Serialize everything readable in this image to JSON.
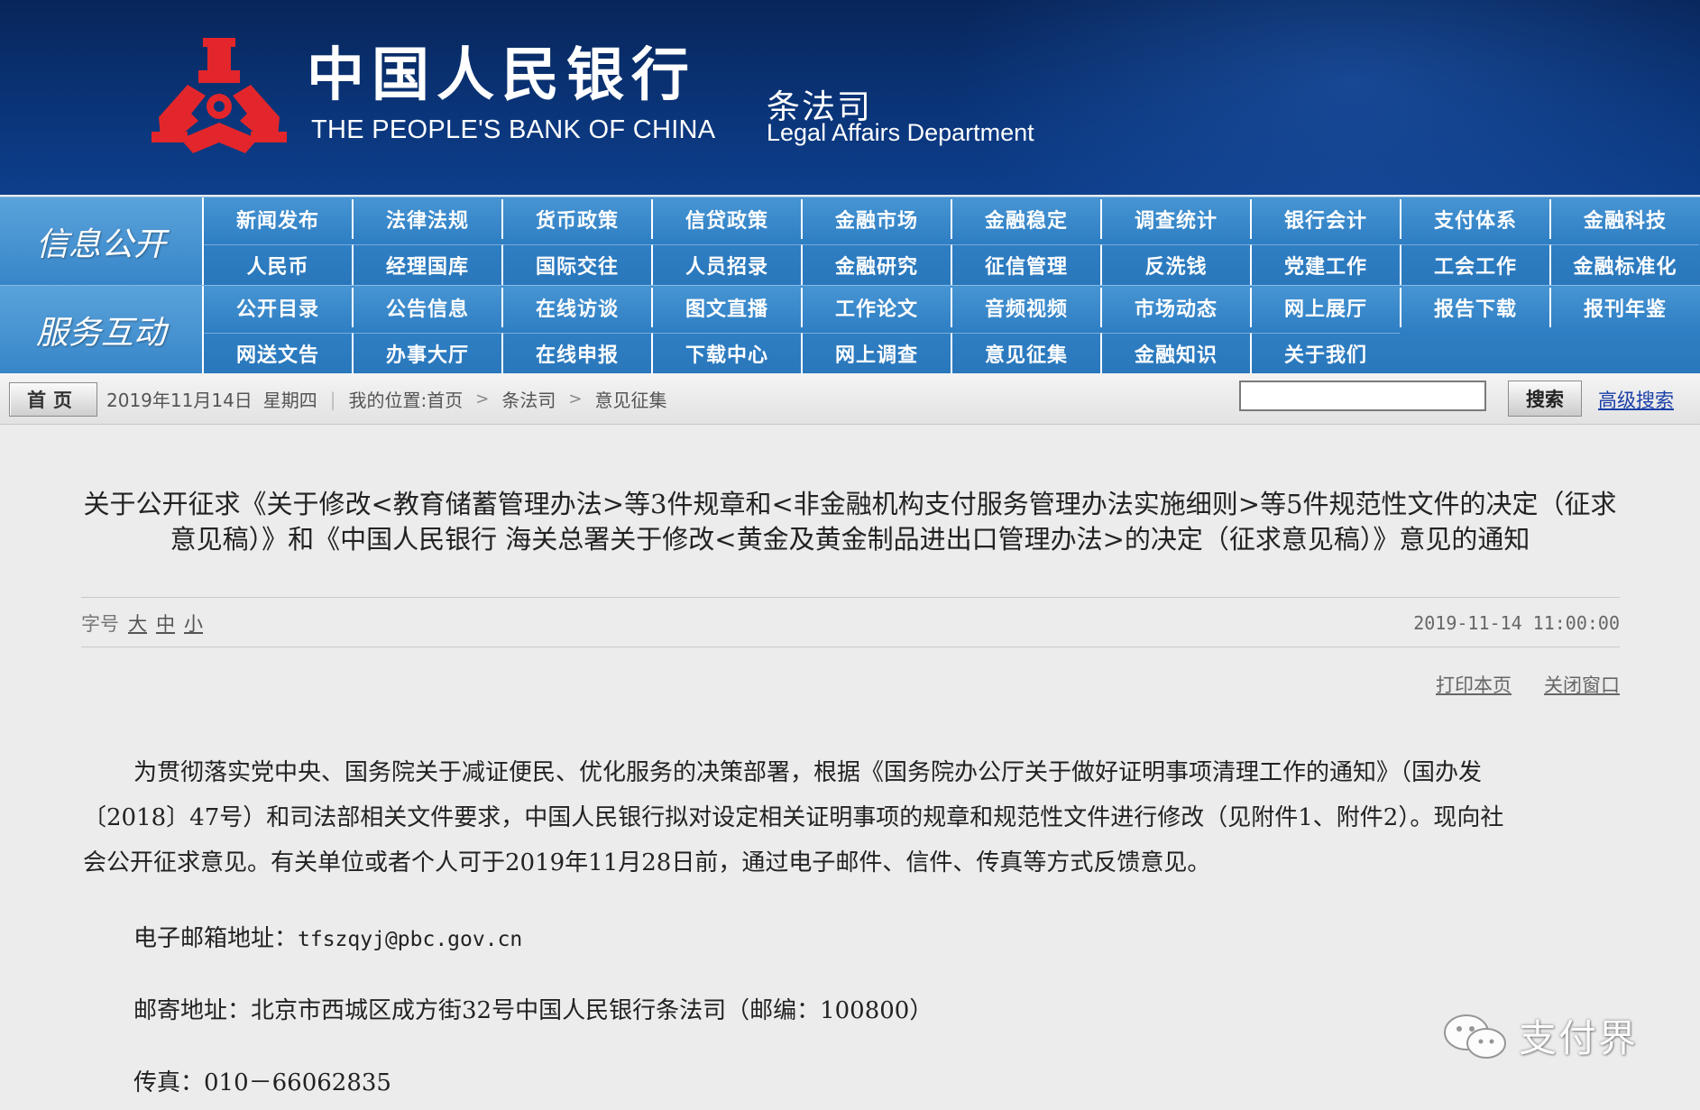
{
  "header": {
    "bank_name_cn": "中国人民银行",
    "bank_name_en": "THE PEOPLE'S BANK OF CHINA",
    "dept_cn": "条法司",
    "dept_en": "Legal Affairs Department",
    "logo_icon": "pboc-emblem-icon",
    "brand_colors": {
      "banner": "#0a3478",
      "nav": "#2f7fc4",
      "logo": "#e3262b"
    }
  },
  "nav": {
    "group1": {
      "label": "信息公开",
      "row1": [
        "新闻发布",
        "法律法规",
        "货币政策",
        "信贷政策",
        "金融市场",
        "金融稳定",
        "调查统计",
        "银行会计",
        "支付体系",
        "金融科技"
      ],
      "row2": [
        "人民币",
        "经理国库",
        "国际交往",
        "人员招录",
        "金融研究",
        "征信管理",
        "反洗钱",
        "党建工作",
        "工会工作",
        "金融标准化"
      ]
    },
    "group2": {
      "label": "服务互动",
      "row1": [
        "公开目录",
        "公告信息",
        "在线访谈",
        "图文直播",
        "工作论文",
        "音频视频",
        "市场动态",
        "网上展厅",
        "报告下载",
        "报刊年鉴"
      ],
      "row2": [
        "网送文告",
        "办事大厅",
        "在线申报",
        "下载中心",
        "网上调查",
        "意见征集",
        "金融知识",
        "关于我们"
      ]
    }
  },
  "locbar": {
    "home_label": "首页",
    "date": "2019年11月14日",
    "weekday": "星期四",
    "location_prefix": "我的位置:",
    "breadcrumbs": [
      "首页",
      "条法司",
      "意见征集"
    ],
    "search_value": "",
    "search_button": "搜索",
    "advanced_search": "高级搜索"
  },
  "article": {
    "title_line1": "关于公开征求《关于修改<教育储蓄管理办法>等3件规章和<非金融机构支付服务管理办法实施细则>等5件规范性文件的决定（征求",
    "title_line2": "意见稿）》和《中国人民银行 海关总署关于修改<黄金及黄金制品进出口管理办法>的决定（征求意见稿）》意见的通知",
    "font_size_label": "字号",
    "font_sizes": [
      "大",
      "中",
      "小"
    ],
    "publish_time": "2019-11-14 11:00:00",
    "print_label": "打印本页",
    "close_label": "关闭窗口",
    "paragraph1_line1": "为贯彻落实党中央、国务院关于减证便民、优化服务的决策部署，根据《国务院办公厅关于做好证明事项清理工作的通知》（国办发",
    "paragraph1_line2": "〔2018〕47号）和司法部相关文件要求，中国人民银行拟对设定相关证明事项的规章和规范性文件进行修改（见附件1、附件2）。现向社",
    "paragraph1_line3": "会公开征求意见。有关单位或者个人可于2019年11月28日前，通过电子邮件、信件、传真等方式反馈意见。",
    "email_label": "电子邮箱地址：",
    "email_value": "tfszqyj@pbc.gov.cn",
    "post_label": "邮寄地址：",
    "post_value": "北京市西城区成方街32号中国人民银行条法司（邮编：100800）",
    "fax_label": "传真：",
    "fax_value": "010－66062835"
  },
  "watermark": {
    "icon": "wechat-icon",
    "text": "支付界"
  }
}
